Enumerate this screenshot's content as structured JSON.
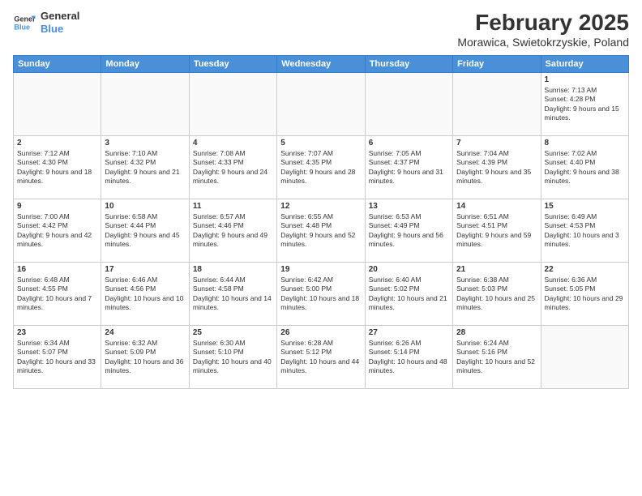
{
  "logo": {
    "line1": "General",
    "line2": "Blue"
  },
  "title": "February 2025",
  "subtitle": "Morawica, Swietokrzyskie, Poland",
  "days_of_week": [
    "Sunday",
    "Monday",
    "Tuesday",
    "Wednesday",
    "Thursday",
    "Friday",
    "Saturday"
  ],
  "weeks": [
    [
      {
        "day": "",
        "info": ""
      },
      {
        "day": "",
        "info": ""
      },
      {
        "day": "",
        "info": ""
      },
      {
        "day": "",
        "info": ""
      },
      {
        "day": "",
        "info": ""
      },
      {
        "day": "",
        "info": ""
      },
      {
        "day": "1",
        "info": "Sunrise: 7:13 AM\nSunset: 4:28 PM\nDaylight: 9 hours and 15 minutes."
      }
    ],
    [
      {
        "day": "2",
        "info": "Sunrise: 7:12 AM\nSunset: 4:30 PM\nDaylight: 9 hours and 18 minutes."
      },
      {
        "day": "3",
        "info": "Sunrise: 7:10 AM\nSunset: 4:32 PM\nDaylight: 9 hours and 21 minutes."
      },
      {
        "day": "4",
        "info": "Sunrise: 7:08 AM\nSunset: 4:33 PM\nDaylight: 9 hours and 24 minutes."
      },
      {
        "day": "5",
        "info": "Sunrise: 7:07 AM\nSunset: 4:35 PM\nDaylight: 9 hours and 28 minutes."
      },
      {
        "day": "6",
        "info": "Sunrise: 7:05 AM\nSunset: 4:37 PM\nDaylight: 9 hours and 31 minutes."
      },
      {
        "day": "7",
        "info": "Sunrise: 7:04 AM\nSunset: 4:39 PM\nDaylight: 9 hours and 35 minutes."
      },
      {
        "day": "8",
        "info": "Sunrise: 7:02 AM\nSunset: 4:40 PM\nDaylight: 9 hours and 38 minutes."
      }
    ],
    [
      {
        "day": "9",
        "info": "Sunrise: 7:00 AM\nSunset: 4:42 PM\nDaylight: 9 hours and 42 minutes."
      },
      {
        "day": "10",
        "info": "Sunrise: 6:58 AM\nSunset: 4:44 PM\nDaylight: 9 hours and 45 minutes."
      },
      {
        "day": "11",
        "info": "Sunrise: 6:57 AM\nSunset: 4:46 PM\nDaylight: 9 hours and 49 minutes."
      },
      {
        "day": "12",
        "info": "Sunrise: 6:55 AM\nSunset: 4:48 PM\nDaylight: 9 hours and 52 minutes."
      },
      {
        "day": "13",
        "info": "Sunrise: 6:53 AM\nSunset: 4:49 PM\nDaylight: 9 hours and 56 minutes."
      },
      {
        "day": "14",
        "info": "Sunrise: 6:51 AM\nSunset: 4:51 PM\nDaylight: 9 hours and 59 minutes."
      },
      {
        "day": "15",
        "info": "Sunrise: 6:49 AM\nSunset: 4:53 PM\nDaylight: 10 hours and 3 minutes."
      }
    ],
    [
      {
        "day": "16",
        "info": "Sunrise: 6:48 AM\nSunset: 4:55 PM\nDaylight: 10 hours and 7 minutes."
      },
      {
        "day": "17",
        "info": "Sunrise: 6:46 AM\nSunset: 4:56 PM\nDaylight: 10 hours and 10 minutes."
      },
      {
        "day": "18",
        "info": "Sunrise: 6:44 AM\nSunset: 4:58 PM\nDaylight: 10 hours and 14 minutes."
      },
      {
        "day": "19",
        "info": "Sunrise: 6:42 AM\nSunset: 5:00 PM\nDaylight: 10 hours and 18 minutes."
      },
      {
        "day": "20",
        "info": "Sunrise: 6:40 AM\nSunset: 5:02 PM\nDaylight: 10 hours and 21 minutes."
      },
      {
        "day": "21",
        "info": "Sunrise: 6:38 AM\nSunset: 5:03 PM\nDaylight: 10 hours and 25 minutes."
      },
      {
        "day": "22",
        "info": "Sunrise: 6:36 AM\nSunset: 5:05 PM\nDaylight: 10 hours and 29 minutes."
      }
    ],
    [
      {
        "day": "23",
        "info": "Sunrise: 6:34 AM\nSunset: 5:07 PM\nDaylight: 10 hours and 33 minutes."
      },
      {
        "day": "24",
        "info": "Sunrise: 6:32 AM\nSunset: 5:09 PM\nDaylight: 10 hours and 36 minutes."
      },
      {
        "day": "25",
        "info": "Sunrise: 6:30 AM\nSunset: 5:10 PM\nDaylight: 10 hours and 40 minutes."
      },
      {
        "day": "26",
        "info": "Sunrise: 6:28 AM\nSunset: 5:12 PM\nDaylight: 10 hours and 44 minutes."
      },
      {
        "day": "27",
        "info": "Sunrise: 6:26 AM\nSunset: 5:14 PM\nDaylight: 10 hours and 48 minutes."
      },
      {
        "day": "28",
        "info": "Sunrise: 6:24 AM\nSunset: 5:16 PM\nDaylight: 10 hours and 52 minutes."
      },
      {
        "day": "",
        "info": ""
      }
    ]
  ]
}
